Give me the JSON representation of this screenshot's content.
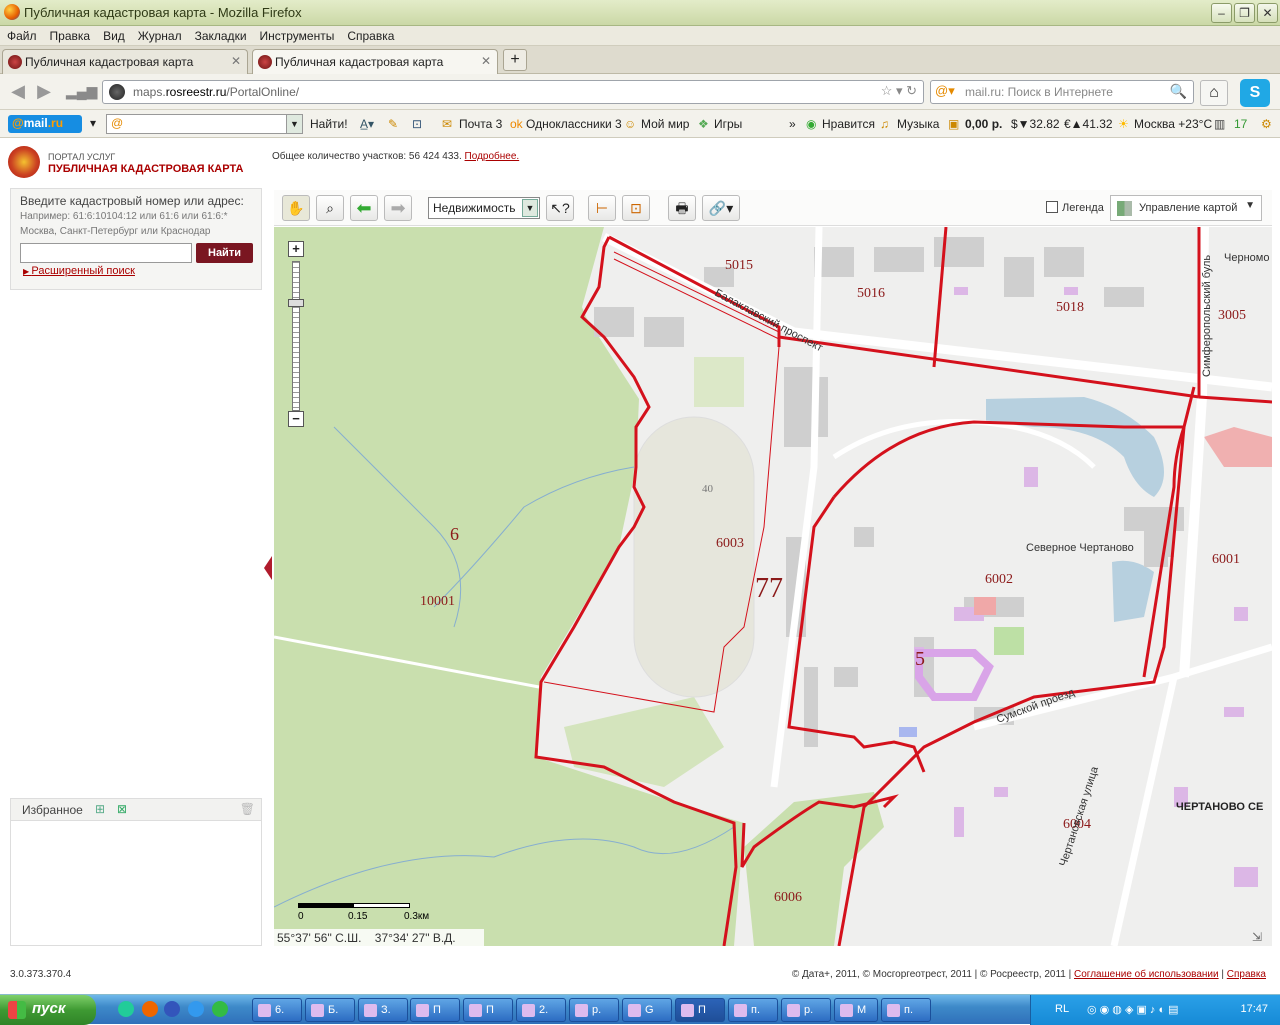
{
  "window": {
    "title": "Публичная кадастровая карта - Mozilla Firefox"
  },
  "menu": [
    "Файл",
    "Правка",
    "Вид",
    "Журнал",
    "Закладки",
    "Инструменты",
    "Справка"
  ],
  "tabs": [
    {
      "label": "Публичная кадастровая карта",
      "active": false
    },
    {
      "label": "Публичная кадастровая карта",
      "active": true
    }
  ],
  "nav": {
    "url_plain": "maps.",
    "url_domain": "rosreestr.ru",
    "url_path": "/PortalOnline/",
    "search_placeholder": "mail.ru: Поиск в Интернете"
  },
  "mailbar": {
    "logo_a": "@",
    "logo_b": "mail",
    "logo_c": ".ru",
    "find_btn": "Найти!",
    "items": [
      "Почта 3",
      "Одноклассники 3",
      "Мой мир",
      "Игры",
      "»",
      "Нравится",
      "Музыка",
      "0,00 р.",
      "$▼32.82",
      "€▲41.32",
      "Москва +23°C",
      "17"
    ]
  },
  "portal": {
    "top_label": "ПОРТАЛ УСЛУГ",
    "name": "ПУБЛИЧНАЯ КАДАСТРОВАЯ КАРТА",
    "count_text": "Общее количество участков: 56 424 433.",
    "more_link": "Подробнее."
  },
  "search_panel": {
    "label": "Введите кадастровый номер или адрес:",
    "example_line1": "Например: 61:6:10104:12 или 61:6 или 61:6:*",
    "example_line2": "Москва, Санкт-Петербург или Краснодар",
    "find_btn": "Найти",
    "advanced": "Расширенный поиск"
  },
  "favorites": {
    "title": "Избранное"
  },
  "map_toolbar": {
    "layer_value": "Недвижимость",
    "legend_label": "Легенда",
    "map_control_label": "Управление картой"
  },
  "map": {
    "labels": {
      "d6": "6",
      "d10001": "10001",
      "d77": "77",
      "d40": "40",
      "d6003": "6003",
      "d5015": "5015",
      "d5016": "5016",
      "d5018": "5018",
      "d3005": "3005",
      "d6001": "6001",
      "d6002": "6002",
      "d5": "5",
      "d6004": "6004",
      "d6006": "6006"
    },
    "streets": {
      "balaklava": "Балаклавский проспект",
      "simfer": "Симферопольский буль",
      "chernomor": "Черномо",
      "sev_chert": "Северное Чертаново",
      "sumskoy": "Сумской проезд",
      "chert_ul": "Чертановская улица",
      "chert_sev": "ЧЕРТАНОВО СЕ"
    },
    "scale": {
      "s0": "0",
      "s1": "0.15",
      "s2": "0.3км"
    },
    "coords": {
      "lat": "55°37' 56\"",
      "lat_suffix": "С.Ш.",
      "lon": "37°34' 27\"",
      "lon_suffix": "В.Д."
    }
  },
  "footer": {
    "version": "3.0.373.370.4",
    "copyright": "© Дата+, 2011, © Мосгоргеотрест, 2011 | © Росреестр, 2011 |",
    "terms": "Соглашение об использовании",
    "help": "Справка"
  },
  "taskbar": {
    "start": "пуск",
    "buttons": [
      "6.",
      "Б.",
      "З.",
      "П",
      "П",
      "2.",
      "р.",
      "G",
      "П",
      "п.",
      "р.",
      "М",
      "п."
    ],
    "lang": "RL",
    "clock": "17:47"
  }
}
